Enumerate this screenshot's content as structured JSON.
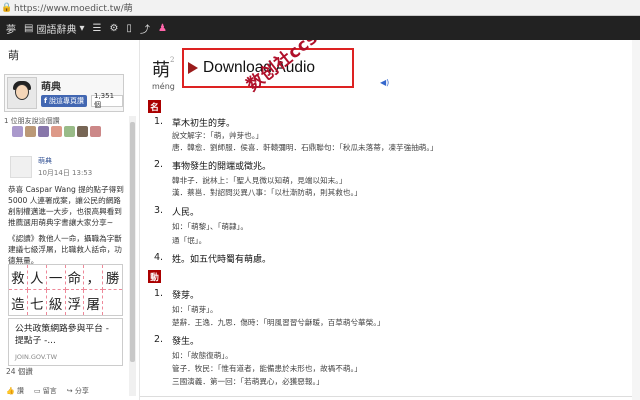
{
  "browser": {
    "url": "https://www.moedict.tw/萌"
  },
  "navbar": {
    "brand": "夢",
    "dict_label": "國語辭典",
    "caret": "▾",
    "icons": [
      "list-icon",
      "gear-icon",
      "bookmark-icon",
      "share-icon",
      "robot-icon"
    ]
  },
  "sidebar": {
    "search_value": "萌",
    "fb_page_name": "萌典",
    "like_label": "說這專頁讚",
    "like_count": "1,351 個",
    "friends_like": "1 位朋友說這個讚",
    "post": {
      "author": "萌典",
      "time": "10月14日 13:53",
      "paragraphs": [
        "恭喜 Caspar Wang 提的點子得到 5000 人連署成案，讓公民的網路創制權邁進一大步，也很高興看到推薦選用萌典字書讓大家分享~",
        "《認讀》教他人一命，攝職為字斷建議七級浮屠，比職救人話命，功德無量。"
      ],
      "calligraphy": [
        "救",
        "人",
        "一",
        "命",
        "，",
        "勝",
        "造",
        "七",
        "級",
        "浮",
        "屠",
        ""
      ],
      "link_title": "公共政策網路參與平台 - 提點子 -...",
      "link_domain": "JOIN.GOV.TW",
      "comments": "24 個讚",
      "actions": [
        "讚",
        "留言",
        "分享"
      ]
    }
  },
  "main": {
    "headword": "萌",
    "headword_sup": "2",
    "pinyin": "méng",
    "audio_label": "Download Audio",
    "watermark": "数创社ccs66",
    "pos_noun": "名",
    "pos_verb": "動",
    "defs": [
      {
        "num": "1.",
        "text": "草木初生的芽。",
        "examples": [
          "說文解字：「萌，艸芽也。」",
          "唐．韓愈．劉師服．侯喜．軒轅彌明．石鼎聯句：「秋瓜未落蒂，凍芋強抽萌。」"
        ]
      },
      {
        "num": "2.",
        "text": "事物發生的開端或徵兆。",
        "examples": [
          "韓非子．說林上：「聖人見微以知萌，見端以知末。」",
          "漢．蔡邕．對詔問災異八事：「以杜漸防萌，則其救也。」"
        ]
      },
      {
        "num": "3.",
        "text": "人民。",
        "examples": [
          "如：「萌黎」、「萌隸」。",
          "通「氓」。"
        ]
      },
      {
        "num": "4.",
        "text": "姓。如五代時蜀有萌慮。",
        "examples": []
      },
      {
        "num": "1.",
        "text": "發芽。",
        "examples": [
          "如：「萌芽」。",
          "楚辭．王逸．九思．傷時：「明風習習兮龢暖，百草萌兮華榮。」"
        ]
      },
      {
        "num": "2.",
        "text": "發生。",
        "examples": [
          "如：「故態復萌」。",
          "管子．牧民：「惟有道者，能備患於未形也，故禍不萌。」",
          "三國演義．第一回：「若萌異心，必獲惡報。」"
        ]
      }
    ]
  }
}
